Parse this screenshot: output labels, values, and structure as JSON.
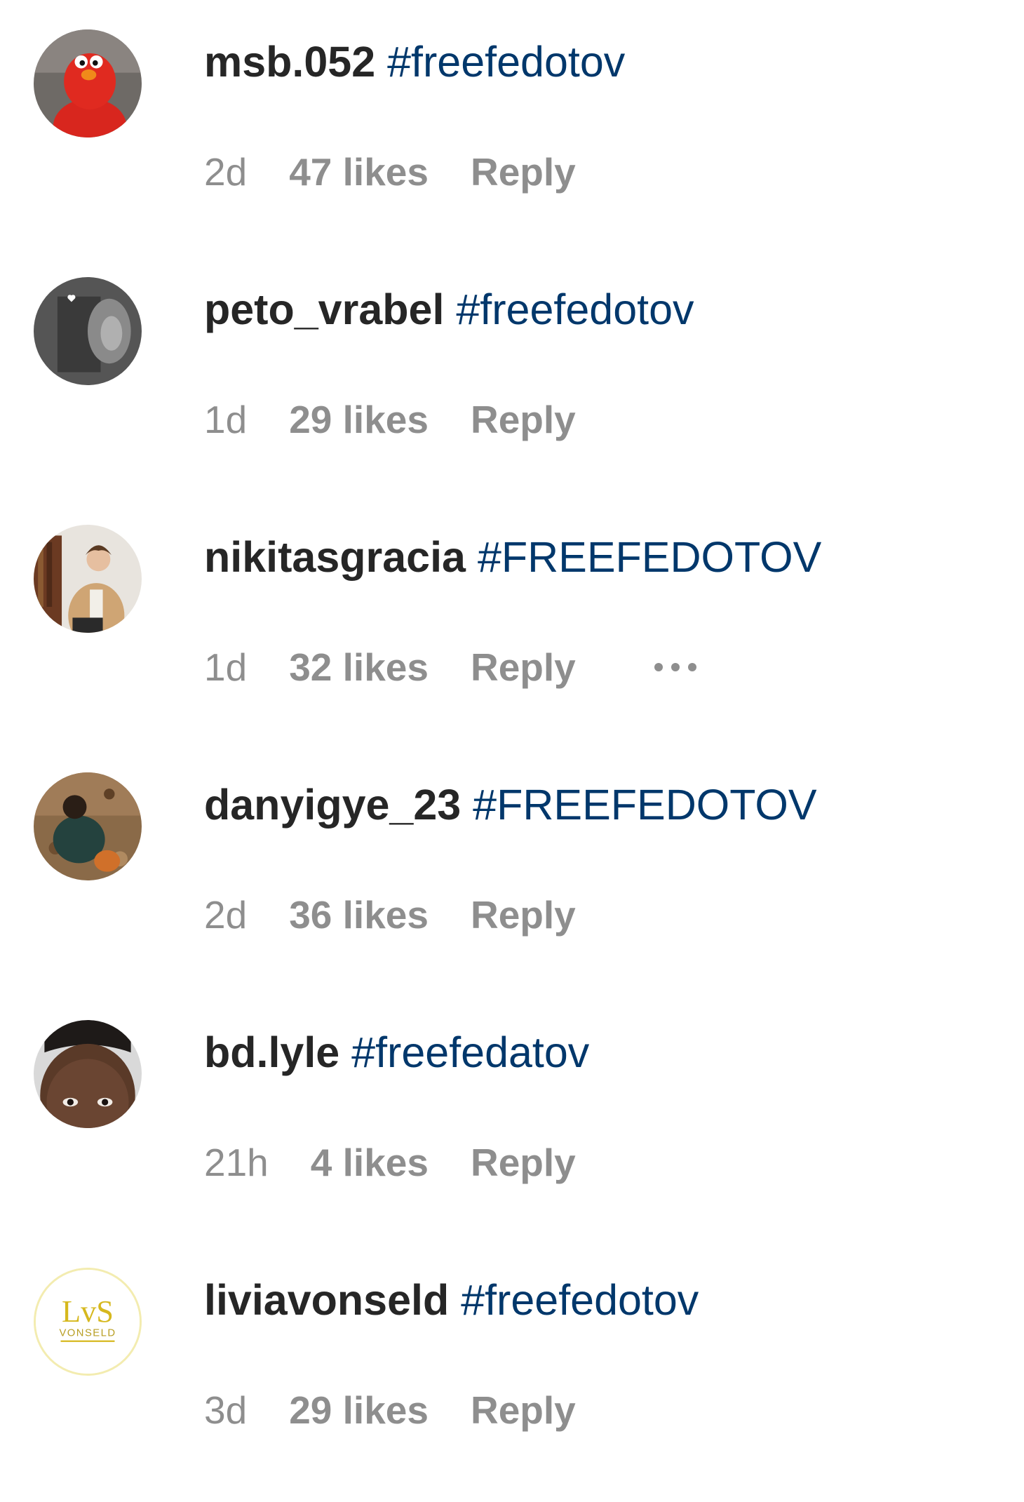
{
  "colors": {
    "username": "#262626",
    "hashtag": "#00376b",
    "meta": "#8e8e8e",
    "background": "#ffffff"
  },
  "comments": [
    {
      "username": "msb.052",
      "text": "#freefedotov",
      "time": "2d",
      "likes": "47 likes",
      "reply": "Reply",
      "avatar_icon": "red-plush-avatar"
    },
    {
      "username": "peto_vrabel",
      "text": "#freefedotov",
      "time": "1d",
      "likes": "29 likes",
      "reply": "Reply",
      "avatar_icon": "gray-photo-avatar"
    },
    {
      "username": "nikitasgracia",
      "text": "#FREEFEDOTOV",
      "time": "1d",
      "likes": "32 likes",
      "reply": "Reply",
      "avatar_icon": "person-beige-jacket-avatar",
      "more_icon": "more-options-icon"
    },
    {
      "username": "danyigye_23",
      "text": "#FREEFEDOTOV",
      "time": "2d",
      "likes": "36 likes",
      "reply": "Reply",
      "avatar_icon": "person-outdoor-avatar"
    },
    {
      "username": "bd.lyle",
      "text": "#freefedatov",
      "time": "21h",
      "likes": "4 likes",
      "reply": "Reply",
      "avatar_icon": "face-closeup-avatar"
    },
    {
      "username": "liviavonseld",
      "text": "#freefedotov",
      "time": "3d",
      "likes": "29 likes",
      "reply": "Reply",
      "avatar_icon": "lvs-logo-avatar",
      "avatar_logo_text": "LvS",
      "avatar_logo_subtext": "VONSELD"
    }
  ]
}
